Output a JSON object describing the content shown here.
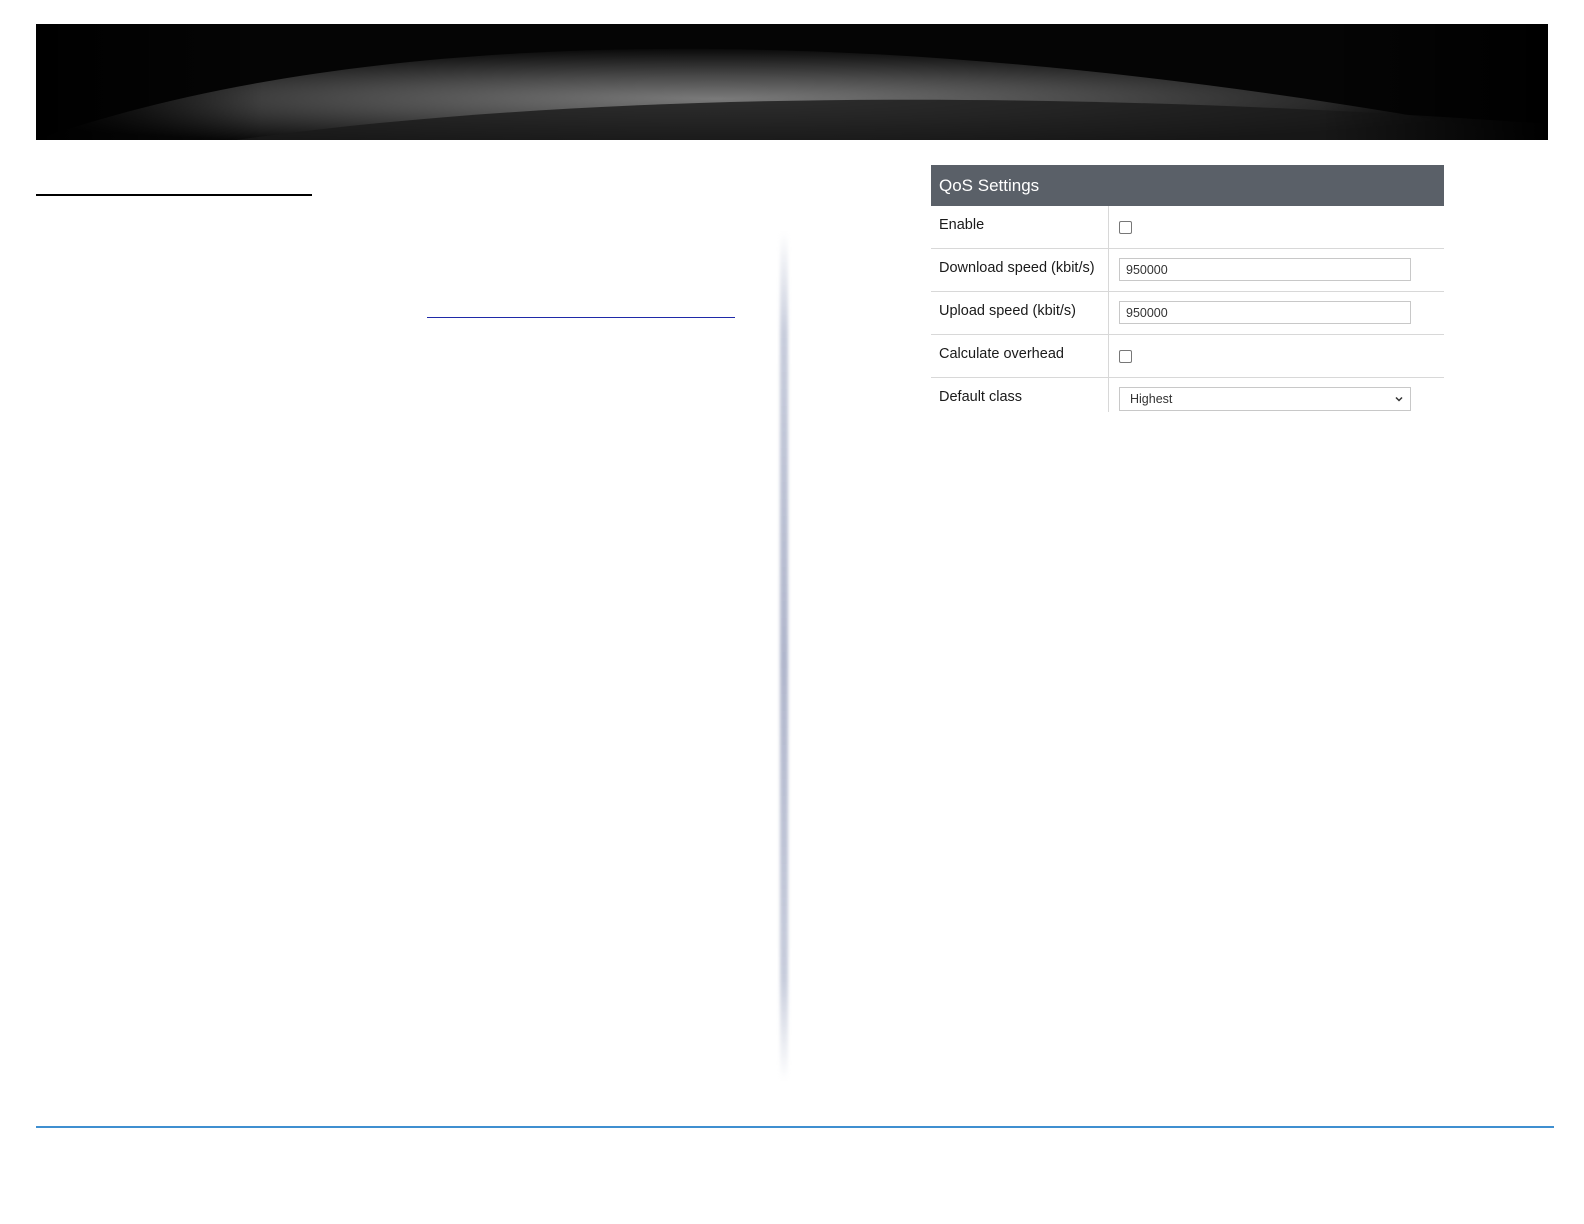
{
  "qos_panel": {
    "title": "QoS Settings",
    "rows": [
      {
        "label": "Enable",
        "control": "checkbox",
        "checked": false
      },
      {
        "label": "Download speed (kbit/s)",
        "control": "text",
        "value": "950000"
      },
      {
        "label": "Upload speed (kbit/s)",
        "control": "text",
        "value": "950000"
      },
      {
        "label": "Calculate overhead",
        "control": "checkbox",
        "checked": false
      },
      {
        "label": "Default class",
        "control": "select",
        "value": "Highest"
      }
    ]
  },
  "colors": {
    "panel_header": "#5a6068",
    "footer_line": "#3f8fd0",
    "link_underline": "#1f2aa8"
  },
  "icons": {
    "select_arrow": "chevron-down-icon"
  }
}
